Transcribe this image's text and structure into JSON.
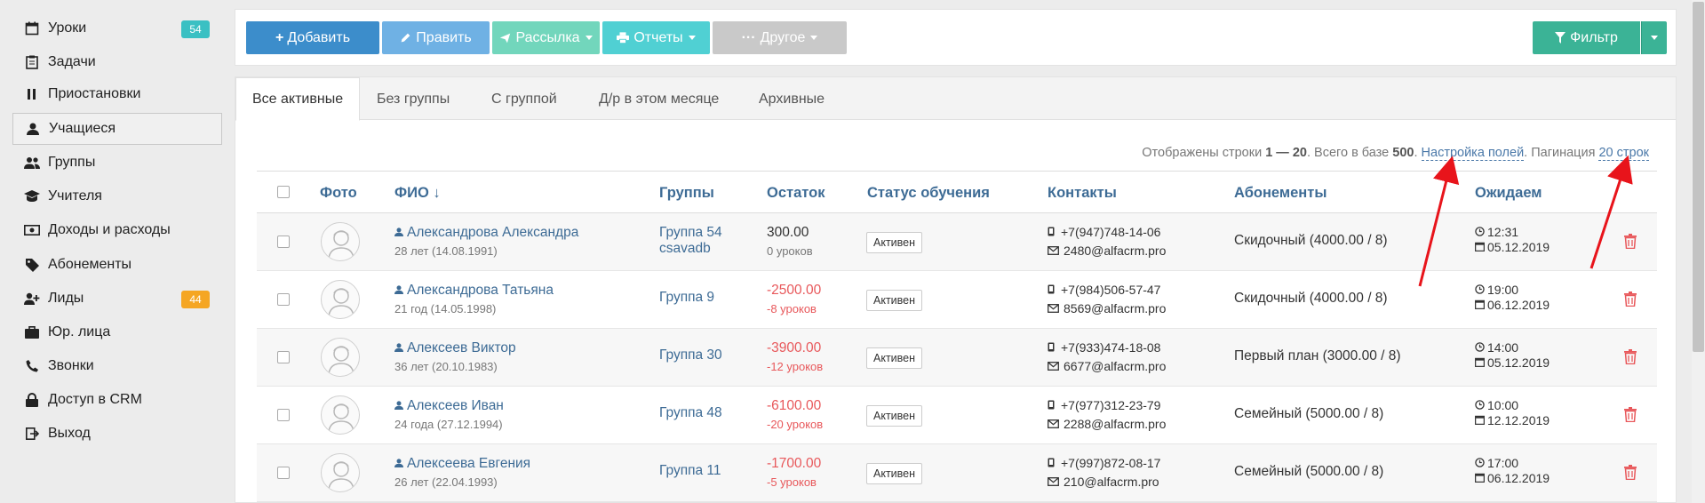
{
  "sidebar": {
    "items": [
      {
        "label": "Уроки",
        "icon": "calendar-icon",
        "badge": "54",
        "badge_color": "#3ac0c3"
      },
      {
        "label": "Задачи",
        "icon": "clipboard-icon"
      },
      {
        "label": "Приостановки",
        "icon": "pause-icon"
      },
      {
        "label": "Учащиеся",
        "icon": "user-icon",
        "active": true
      },
      {
        "label": "Группы",
        "icon": "users-icon"
      },
      {
        "label": "Учителя",
        "icon": "graduation-cap-icon"
      },
      {
        "label": "Доходы и расходы",
        "icon": "money-icon"
      },
      {
        "label": "Абонементы",
        "icon": "tag-icon"
      },
      {
        "label": "Лиды",
        "icon": "user-plus-icon",
        "badge": "44",
        "badge_color": "#f5a623"
      },
      {
        "label": "Юр. лица",
        "icon": "briefcase-icon"
      },
      {
        "label": "Звонки",
        "icon": "phone-icon"
      },
      {
        "label": "Доступ в CRM",
        "icon": "lock-icon"
      },
      {
        "label": "Выход",
        "icon": "sign-out-icon"
      }
    ]
  },
  "toolbar": {
    "add_label": "Добавить",
    "edit_label": "Править",
    "mailing_label": "Рассылка",
    "reports_label": "Отчеты",
    "other_label": "Другое",
    "filter_label": "Фильтр",
    "colors": {
      "add": "#3c8dcb",
      "edit": "#6fb1e4",
      "mailing": "#72d6bc",
      "reports": "#50d0d3",
      "other": "#c9c9c9",
      "filter": "#3bb396"
    }
  },
  "tabs": [
    "Все активные",
    "Без группы",
    "С группой",
    "Д/р в этом месяце",
    "Архивные"
  ],
  "info": {
    "prefix": "Отображены строки ",
    "range": "1 — 20",
    "middle": ". Всего в базе ",
    "total": "500",
    "dot": ".",
    "fields_link": "Настройка полей",
    "pagination_label": ". Пагинация ",
    "rows_link": "20 строк"
  },
  "table": {
    "headers": {
      "photo": "Фото",
      "name": "ФИО ↓",
      "groups": "Группы",
      "balance": "Остаток",
      "status": "Статус обучения",
      "contacts": "Контакты",
      "subscriptions": "Абонементы",
      "expected": "Ожидаем"
    },
    "rows": [
      {
        "name": "Александрова Александра",
        "age": "28 лет (14.08.1991)",
        "groups": [
          "Группа 54",
          "csavadb"
        ],
        "balance": "300.00",
        "lessons": "0 уроков",
        "negative": false,
        "status": "Активен",
        "phone": "+7(947)748-14-06",
        "email": "2480@alfacrm.pro",
        "subscription": "Скидочный (4000.00 / 8)",
        "time": "12:31",
        "date": "05.12.2019"
      },
      {
        "name": "Александрова Татьяна",
        "age": "21 год (14.05.1998)",
        "groups": [
          "Группа 9"
        ],
        "balance": "-2500.00",
        "lessons": "-8 уроков",
        "negative": true,
        "status": "Активен",
        "phone": "+7(984)506-57-47",
        "email": "8569@alfacrm.pro",
        "subscription": "Скидочный (4000.00 / 8)",
        "time": "19:00",
        "date": "06.12.2019"
      },
      {
        "name": "Алексеев Виктор",
        "age": "36 лет (20.10.1983)",
        "groups": [
          "Группа 30"
        ],
        "balance": "-3900.00",
        "lessons": "-12 уроков",
        "negative": true,
        "status": "Активен",
        "phone": "+7(933)474-18-08",
        "email": "6677@alfacrm.pro",
        "subscription": "Первый план (3000.00 / 8)",
        "time": "14:00",
        "date": "05.12.2019"
      },
      {
        "name": "Алексеев Иван",
        "age": "24 года (27.12.1994)",
        "groups": [
          "Группа 48"
        ],
        "balance": "-6100.00",
        "lessons": "-20 уроков",
        "negative": true,
        "status": "Активен",
        "phone": "+7(977)312-23-79",
        "email": "2288@alfacrm.pro",
        "subscription": "Семейный (5000.00 / 8)",
        "time": "10:00",
        "date": "12.12.2019"
      },
      {
        "name": "Алексеева Евгения",
        "age": "26 лет (22.04.1993)",
        "groups": [
          "Группа 11"
        ],
        "balance": "-1700.00",
        "lessons": "-5 уроков",
        "negative": true,
        "status": "Активен",
        "phone": "+7(997)872-08-17",
        "email": "210@alfacrm.pro",
        "subscription": "Семейный (5000.00 / 8)",
        "time": "17:00",
        "date": "06.12.2019"
      }
    ]
  },
  "annotation": {
    "arrow_color": "#e8141b"
  }
}
